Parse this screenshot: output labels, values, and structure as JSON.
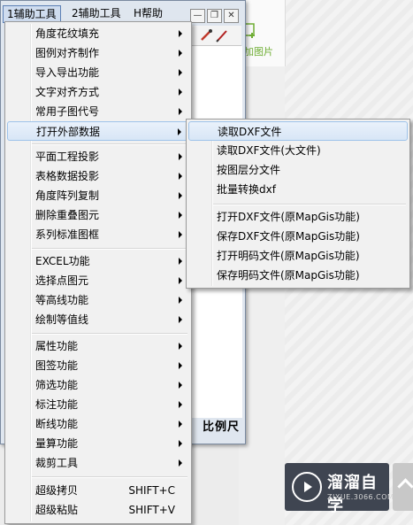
{
  "background": {
    "add_picture_label": "加图片",
    "watermark_title": "溜溜自学",
    "watermark_subtitle": "ZIXUE.3066.COM"
  },
  "menubar": {
    "items": [
      {
        "label": "1辅助工具",
        "active": true
      },
      {
        "label": "2辅助工具",
        "active": false
      },
      {
        "label": "H帮助",
        "active": false
      }
    ],
    "window_buttons": [
      "minimize-icon",
      "restore-icon",
      "close-icon"
    ]
  },
  "canvas": {
    "scale_label": "比例尺"
  },
  "dropdown": {
    "items": [
      {
        "label": "角度花纹填充",
        "submenu": true
      },
      {
        "label": "图例对齐制作",
        "submenu": true
      },
      {
        "label": "导入导出功能",
        "submenu": true
      },
      {
        "label": "文字对齐方式",
        "submenu": true
      },
      {
        "label": "常用子图代号",
        "submenu": true
      },
      {
        "label": "打开外部数据",
        "submenu": true,
        "highlighted": true
      },
      {
        "label": "平面工程投影",
        "submenu": true
      },
      {
        "label": "表格数据投影",
        "submenu": true
      },
      {
        "label": "角度阵列复制",
        "submenu": true
      },
      {
        "label": "删除重叠图元",
        "submenu": true
      },
      {
        "label": "系列标准图框",
        "submenu": true
      },
      {
        "label": "EXCEL功能",
        "submenu": true
      },
      {
        "label": "选择点图元",
        "submenu": true
      },
      {
        "label": "等高线功能",
        "submenu": true
      },
      {
        "label": "绘制等值线",
        "submenu": true
      },
      {
        "label": "属性功能",
        "submenu": true
      },
      {
        "label": "图签功能",
        "submenu": true
      },
      {
        "label": "筛选功能",
        "submenu": true
      },
      {
        "label": "标注功能",
        "submenu": true
      },
      {
        "label": "断线功能",
        "submenu": true
      },
      {
        "label": "量算功能",
        "submenu": true
      },
      {
        "label": "裁剪工具",
        "submenu": true
      },
      {
        "label": "超级拷贝",
        "shortcut": "SHIFT+C"
      },
      {
        "label": "超级粘贴",
        "shortcut": "SHIFT+V"
      }
    ]
  },
  "submenu": {
    "items": [
      {
        "label": "读取DXF文件",
        "highlighted": true
      },
      {
        "label": "读取DXF文件(大文件)"
      },
      {
        "label": "按图层分文件"
      },
      {
        "label": "批量转换dxf"
      },
      {
        "label": "打开DXF文件(原MapGis功能)"
      },
      {
        "label": "保存DXF文件(原MapGis功能)"
      },
      {
        "label": "打开明码文件(原MapGis功能)"
      },
      {
        "label": "保存明码文件(原MapGis功能)"
      }
    ]
  },
  "colors": {
    "highlight_bg": "#dde9f7",
    "highlight_border": "#9ec3ea",
    "menu_bg": "#f1f1f1",
    "accent_green": "#6fae34"
  }
}
